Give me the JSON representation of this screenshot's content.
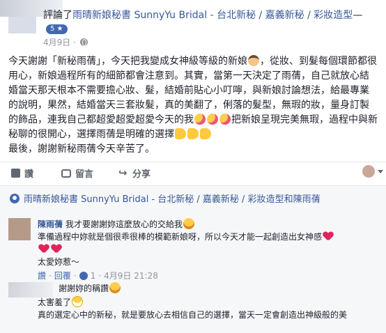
{
  "post": {
    "author_prefix": "評論了",
    "page_name": "雨晴新娘秘書 SunnyYu Bridal - 台北新秘 / 嘉義新秘 / 彩妝造型",
    "follow_badge": "5 ★",
    "date": "4月9日 ·",
    "body_1": "今天謝謝「新秘雨蒨」，今天把我變成女神級等級的新娘",
    "body_2": "，從妝、到髮每個環節都很用心，新娘過程所有的細節都會注意到。其實，當第一天決定了雨蒨，自己就放心結婚當天那天根本不需要擔心妝、髮，結婚前貼心小叮嚀，與新娘討論想法，給最專業的說明，果然，結婚當天三套妝髮，真的美翻了，俐落的髮型，無瑕的妝，量身訂製的飾品，連我自己都超愛超愛超愛今天的我",
    "body_3": "把新娘呈現完美無瑕，過程中與新秘聊的很開心，選擇雨蒨是明確的選擇",
    "body_4": "最後，謝謝新秘雨蒨今天辛苦了。"
  },
  "actions": {
    "like": "讚",
    "comment": "留言",
    "share": "分享"
  },
  "comments": {
    "tag_line": "雨晴新娘秘書 SunnyYu Bridal - 台北新秘 / 嘉義新秘 / 彩妝造型和陳雨蒨",
    "c1": {
      "author": "陳雨蒨",
      "line1": "我才要謝謝妳這麼放心的交給我",
      "line2": "準備過程中妳就是個很乖很棒的模範新娘呀，所以今天才能一起創造出女神感",
      "line3": "太愛妳惹～",
      "like_label": "讚",
      "reply_label": "回覆",
      "likes": "1",
      "time": "4月9日 21:28"
    },
    "c2": {
      "line1": "謝謝妳的稱讚",
      "line2": "太害羞了",
      "line3": "真的選定心中的新秘，就是要放心去相信自己的選擇，當天一定會創造出神級般的美"
    }
  },
  "icons": [
    "globe-icon",
    "like-icon",
    "comment-icon",
    "share-icon",
    "tag-icon"
  ],
  "colors": {
    "link": "#365899",
    "brand": "#4267b2",
    "muted": "#90949c",
    "heart": "#e0245e"
  }
}
